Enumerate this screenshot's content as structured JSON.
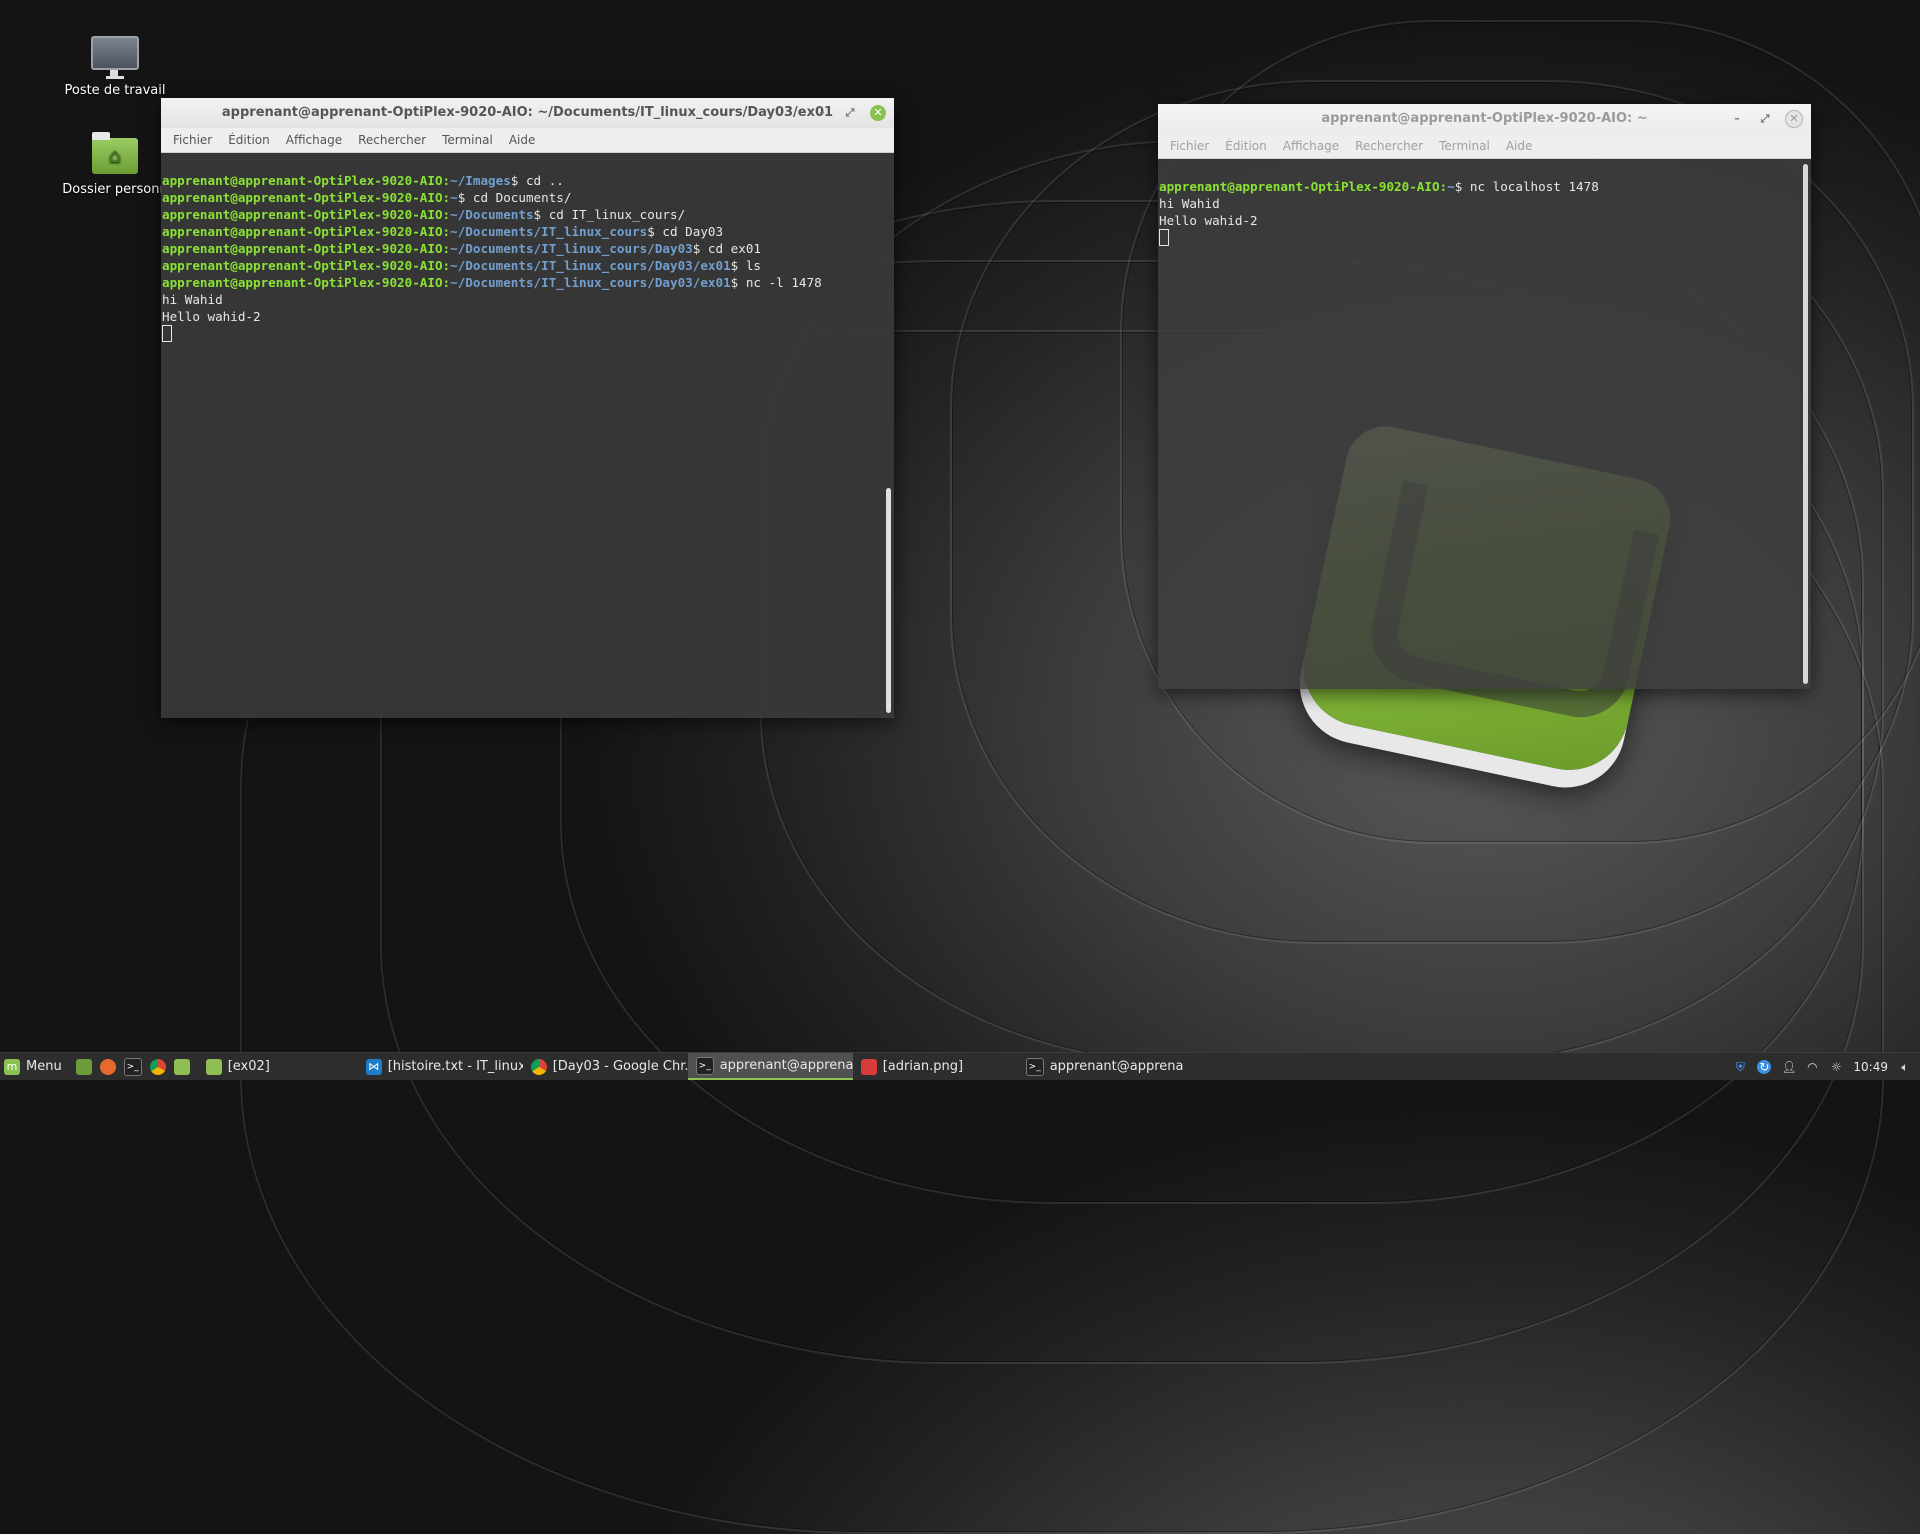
{
  "desktop": {
    "icons": [
      {
        "label": "Poste de travail",
        "icon": "computer-icon"
      },
      {
        "label": "Dossier personn",
        "icon": "home-folder-icon"
      }
    ]
  },
  "terminal_left": {
    "title": "apprenant@apprenant-OptiPlex-9020-AIO: ~/Documents/IT_linux_cours/Day03/ex01",
    "menu": [
      "Fichier",
      "Édition",
      "Affichage",
      "Rechercher",
      "Terminal",
      "Aide"
    ],
    "lines": [
      {
        "user": "apprenant@apprenant-OptiPlex-9020-AIO:",
        "path": "~/Images",
        "cmd": "$ cd .."
      },
      {
        "user": "apprenant@apprenant-OptiPlex-9020-AIO:",
        "path": "~",
        "cmd": "$ cd Documents/"
      },
      {
        "user": "apprenant@apprenant-OptiPlex-9020-AIO:",
        "path": "~/Documents",
        "cmd": "$ cd IT_linux_cours/"
      },
      {
        "user": "apprenant@apprenant-OptiPlex-9020-AIO:",
        "path": "~/Documents/IT_linux_cours",
        "cmd": "$ cd Day03"
      },
      {
        "user": "apprenant@apprenant-OptiPlex-9020-AIO:",
        "path": "~/Documents/IT_linux_cours/Day03",
        "cmd": "$ cd ex01"
      },
      {
        "user": "apprenant@apprenant-OptiPlex-9020-AIO:",
        "path": "~/Documents/IT_linux_cours/Day03/ex01",
        "cmd": "$ ls"
      },
      {
        "user": "apprenant@apprenant-OptiPlex-9020-AIO:",
        "path": "~/Documents/IT_linux_cours/Day03/ex01",
        "cmd": "$ nc -l 1478"
      }
    ],
    "output": [
      "hi Wahid",
      "Hello wahid-2"
    ]
  },
  "terminal_right": {
    "title": "apprenant@apprenant-OptiPlex-9020-AIO: ~",
    "menu": [
      "Fichier",
      "Édition",
      "Affichage",
      "Rechercher",
      "Terminal",
      "Aide"
    ],
    "lines": [
      {
        "user": "apprenant@apprenant-OptiPlex-9020-AIO:",
        "path": "~",
        "cmd": "$ nc localhost 1478"
      }
    ],
    "output": [
      "hi Wahid",
      "Hello wahid-2"
    ]
  },
  "taskbar": {
    "menu_label": "Menu",
    "launchers": [
      "show-desktop-icon",
      "firefox-icon",
      "terminal-icon",
      "chrome-icon",
      "files-icon"
    ],
    "tasks": [
      {
        "label": "[ex02]",
        "icon": "folder-icon",
        "active": false
      },
      {
        "label": "[histoire.txt - IT_linux...",
        "icon": "vscode-icon",
        "active": false
      },
      {
        "label": "[Day03 - Google Chr...",
        "icon": "chrome-icon",
        "active": false
      },
      {
        "label": "apprenant@apprena...",
        "icon": "terminal-icon",
        "active": true
      },
      {
        "label": "[adrian.png]",
        "icon": "image-viewer-icon",
        "active": false
      },
      {
        "label": "apprenant@apprena...",
        "icon": "terminal-icon",
        "active": false
      }
    ],
    "tray": {
      "clock": "10:49",
      "icons": [
        "shield-icon",
        "update-manager-icon",
        "user-icon",
        "wifi-icon",
        "brightness-icon",
        "volume-icon"
      ]
    }
  }
}
